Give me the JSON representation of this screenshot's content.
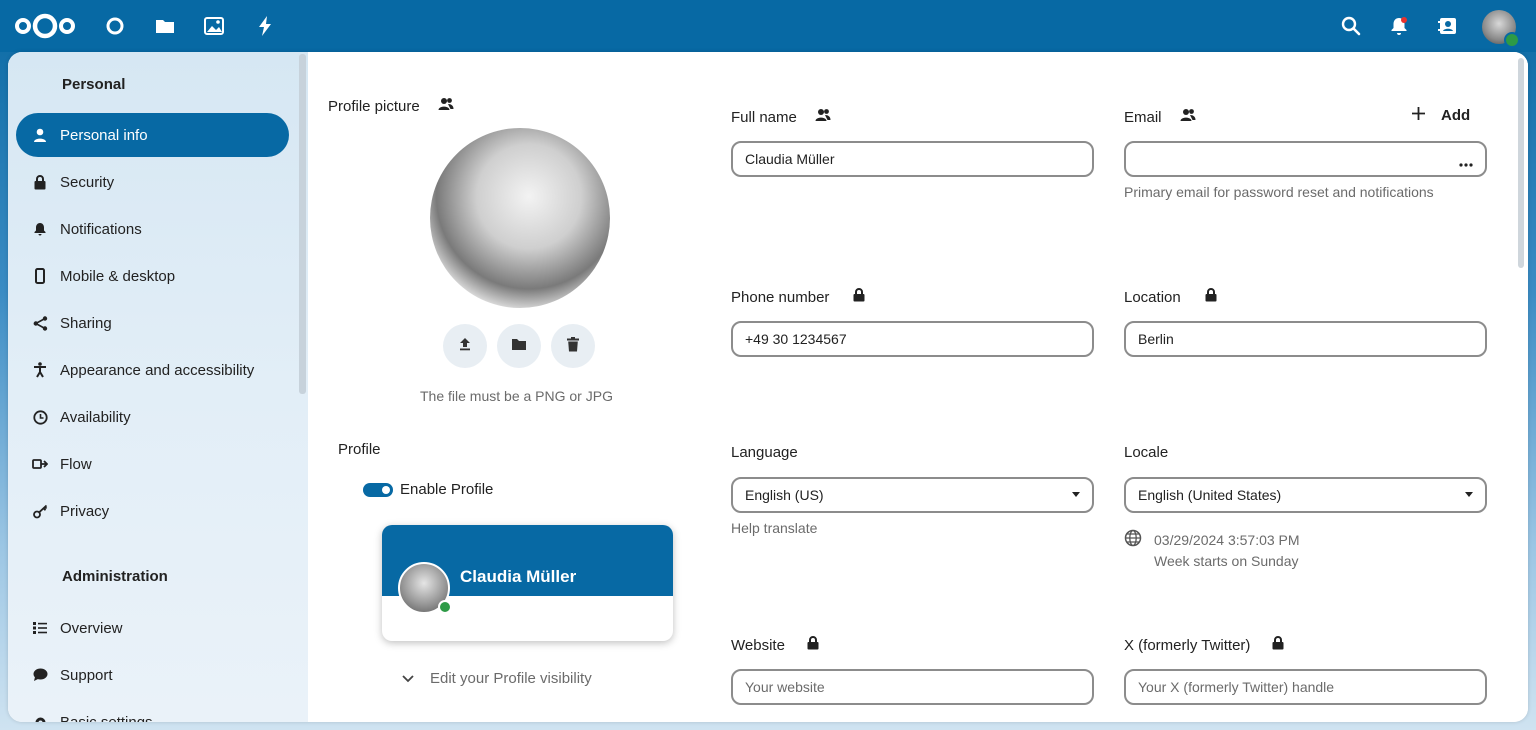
{
  "topbar": {
    "apps": [
      "dashboard-icon",
      "files-icon",
      "photos-icon",
      "activity-icon"
    ],
    "right": [
      "search-icon",
      "notifications-icon",
      "contacts-icon"
    ]
  },
  "sidebar": {
    "personal_title": "Personal",
    "items": [
      {
        "label": "Personal info",
        "icon": "person-icon",
        "active": true
      },
      {
        "label": "Security",
        "icon": "lock-icon"
      },
      {
        "label": "Notifications",
        "icon": "bell-icon"
      },
      {
        "label": "Mobile & desktop",
        "icon": "phone-icon"
      },
      {
        "label": "Sharing",
        "icon": "share-icon"
      },
      {
        "label": "Appearance and accessibility",
        "icon": "accessibility-icon"
      },
      {
        "label": "Availability",
        "icon": "clock-icon"
      },
      {
        "label": "Flow",
        "icon": "flow-icon"
      },
      {
        "label": "Privacy",
        "icon": "key-icon"
      }
    ],
    "admin_title": "Administration",
    "admin_items": [
      {
        "label": "Overview",
        "icon": "list-icon"
      },
      {
        "label": "Support",
        "icon": "chat-icon"
      },
      {
        "label": "Basic settings",
        "icon": "gear-icon"
      }
    ]
  },
  "profile_picture": {
    "label": "Profile picture",
    "hint": "The file must be a PNG or JPG"
  },
  "profile": {
    "label": "Profile",
    "enable_label": "Enable Profile",
    "card_name": "Claudia Müller",
    "visibility_label": "Edit your Profile visibility"
  },
  "fields": {
    "full_name": {
      "label": "Full name",
      "value": "Claudia Müller"
    },
    "email": {
      "label": "Email",
      "add_label": "Add",
      "value": "",
      "hint": "Primary email for password reset and notifications"
    },
    "phone": {
      "label": "Phone number",
      "value": "+49 30 1234567"
    },
    "location": {
      "label": "Location",
      "value": "Berlin"
    },
    "language": {
      "label": "Language",
      "value": "English (US)",
      "hint": "Help translate"
    },
    "locale": {
      "label": "Locale",
      "value": "English (United States)",
      "datetime": "03/29/2024 3:57:03 PM",
      "week": "Week starts on Sunday"
    },
    "website": {
      "label": "Website",
      "placeholder": "Your website"
    },
    "twitter": {
      "label": "X (formerly Twitter)",
      "placeholder": "Your X (formerly Twitter) handle"
    }
  },
  "colors": {
    "primary": "#0769a4",
    "status_online": "#2d9a46"
  }
}
